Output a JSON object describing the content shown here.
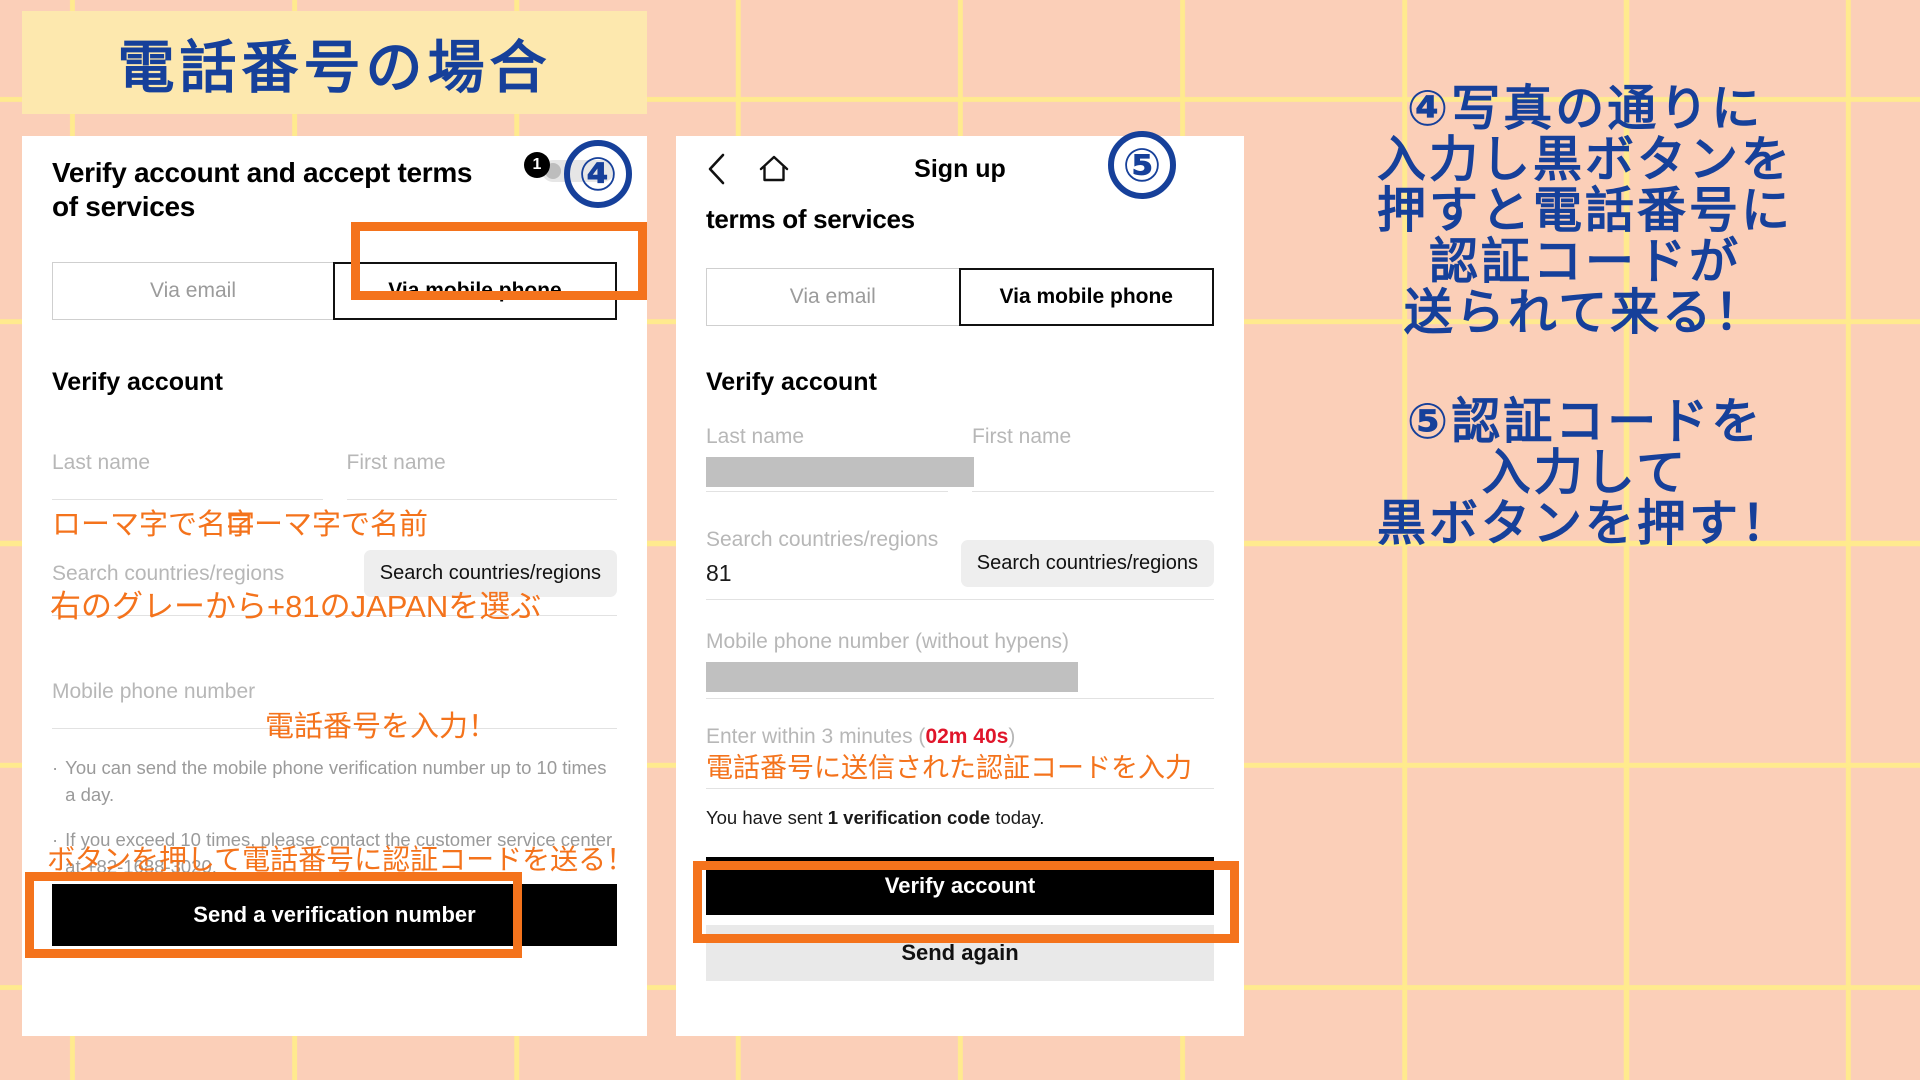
{
  "banner": {
    "title": "電話番号の場合"
  },
  "panel4": {
    "step_label": "④",
    "badge_number": "1",
    "headline": "Verify account and accept terms of services",
    "tabs": [
      {
        "label": "Via email",
        "state": "inactive"
      },
      {
        "label": "Via mobile phone",
        "state": "active"
      }
    ],
    "section_title": "Verify account",
    "fields": {
      "last_name_label": "Last name",
      "first_name_label": "First name",
      "country_label": "Search countries/regions",
      "country_chip": "Search countries/regions",
      "phone_label": "Mobile phone number"
    },
    "bullets": [
      "You can send the mobile phone verification number up to 10 times a day.",
      "If you exceed 10 times, please contact the customer service center at +82-1688-3020."
    ],
    "primary_button": "Send a verification number",
    "annotations": {
      "last_name": "ローマ字で名字",
      "first_name": "ローマ字で名前",
      "country": "右のグレーから+81のJAPANを選ぶ",
      "phone": "電話番号を入力！",
      "send_button": "ボタンを押して電話番号に認証コードを送る！"
    }
  },
  "panel5": {
    "step_label": "⑤",
    "nav": {
      "back_icon": "chevron-left-icon",
      "home_icon": "home-icon",
      "title": "Sign up"
    },
    "headline": "terms of services",
    "tabs": [
      {
        "label": "Via email",
        "state": "inactive"
      },
      {
        "label": "Via mobile phone",
        "state": "active"
      }
    ],
    "section_title": "Verify account",
    "fields": {
      "last_name_label": "Last name",
      "first_name_label": "First name",
      "country_label": "Search countries/regions",
      "country_value": "81",
      "country_chip": "Search countries/regions",
      "phone_label": "Mobile phone number (without hypens)"
    },
    "timer": {
      "prefix": "Enter within 3 minutes (",
      "value": "02m 40s",
      "suffix": ")"
    },
    "sent_note": {
      "before": "You have sent ",
      "bold": "1 verification code",
      "after": " today."
    },
    "primary_button": "Verify account",
    "secondary_button": "Send again",
    "annotations": {
      "code": "電話番号に送信された認証コードを入力"
    }
  },
  "instructions": {
    "step4": [
      "④写真の通りに",
      "入力し黒ボタンを",
      "押すと電話番号に",
      "認証コードが",
      "送られて来る！"
    ],
    "step5": [
      "⑤認証コードを",
      "入力して",
      "黒ボタンを押す！"
    ]
  },
  "colors": {
    "background": "#fbcfb8",
    "grid": "#ffeb8c",
    "banner": "#fde8ae",
    "blue": "#16409a",
    "orange": "#f4731c",
    "red": "#e0152a"
  }
}
